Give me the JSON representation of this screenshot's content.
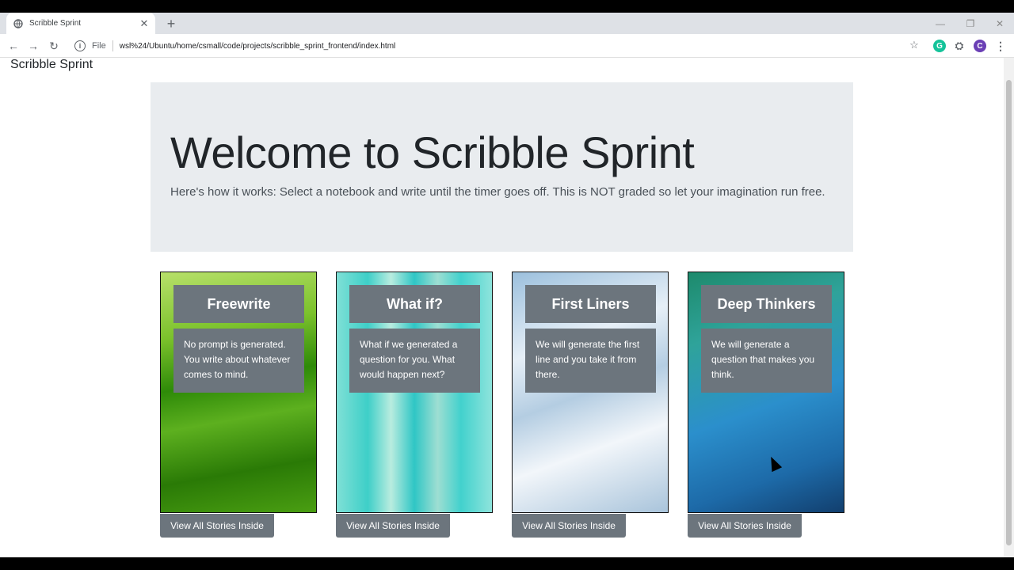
{
  "browser": {
    "tab_title": "Scribble Sprint",
    "url_scheme_label": "File",
    "url": "wsl%24/Ubuntu/home/csmall/code/projects/scribble_sprint_frontend/index.html",
    "profile_initial": "C"
  },
  "navbar": {
    "brand": "Scribble Sprint"
  },
  "jumbotron": {
    "title": "Welcome to Scribble Sprint",
    "lead": "Here's how it works: Select a notebook and write until the timer goes off. This is NOT graded so let your imagination run free."
  },
  "cards": [
    {
      "title": "Freewrite",
      "text": "No prompt is generated. You write about whatever comes to mind.",
      "button": "View All Stories Inside"
    },
    {
      "title": "What if?",
      "text": "What if we generated a question for you. What would happen next?",
      "button": "View All Stories Inside"
    },
    {
      "title": "First Liners",
      "text": "We will generate the first line and you take it from there.",
      "button": "View All Stories Inside"
    },
    {
      "title": "Deep Thinkers",
      "text": "We will generate a question that makes you think.",
      "button": "View All Stories Inside"
    }
  ]
}
